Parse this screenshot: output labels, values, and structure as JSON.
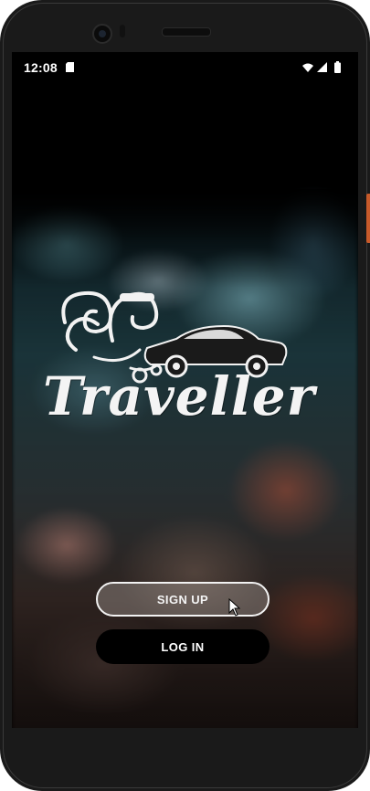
{
  "status_bar": {
    "time": "12:08",
    "icons": [
      "sd-card-icon",
      "wifi-icon",
      "signal-icon",
      "battery-icon"
    ]
  },
  "brand": {
    "name": "Traveller",
    "logo_icon": "wave-car-logo-icon"
  },
  "actions": {
    "signup_label": "SIGN UP",
    "login_label": "LOG IN"
  },
  "navigation": {
    "icons": [
      "back-icon",
      "home-icon",
      "recents-icon"
    ]
  },
  "colors": {
    "primary_button": "#000000",
    "outline_button_border": "#f2f2f2",
    "text": "#ffffff"
  }
}
